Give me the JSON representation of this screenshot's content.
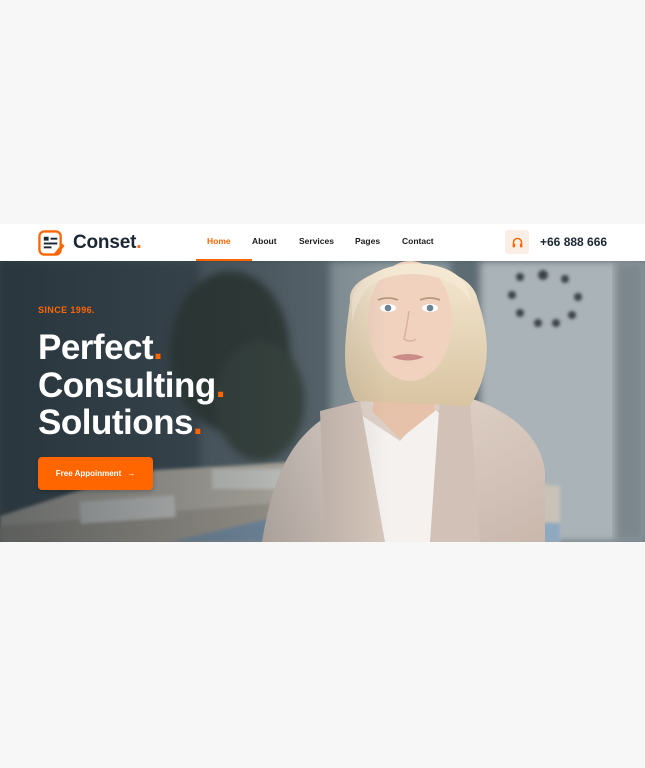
{
  "brand": {
    "name": "Conset",
    "dot": ".",
    "accent_color": "#ff6600"
  },
  "nav": {
    "items": [
      {
        "label": "Home",
        "active": true
      },
      {
        "label": "About",
        "active": false
      },
      {
        "label": "Services",
        "active": false
      },
      {
        "label": "Pages",
        "active": false
      },
      {
        "label": "Contact",
        "active": false
      }
    ]
  },
  "contact": {
    "icon": "headset-icon",
    "phone": "+66 888 666"
  },
  "hero": {
    "eyebrow": "SINCE 1996.",
    "headline": [
      {
        "text": "Perfect",
        "dot": "."
      },
      {
        "text": "Consulting",
        "dot": "."
      },
      {
        "text": "Solutions",
        "dot": "."
      }
    ],
    "cta_label": "Free Appoinment",
    "cta_arrow": "→"
  }
}
